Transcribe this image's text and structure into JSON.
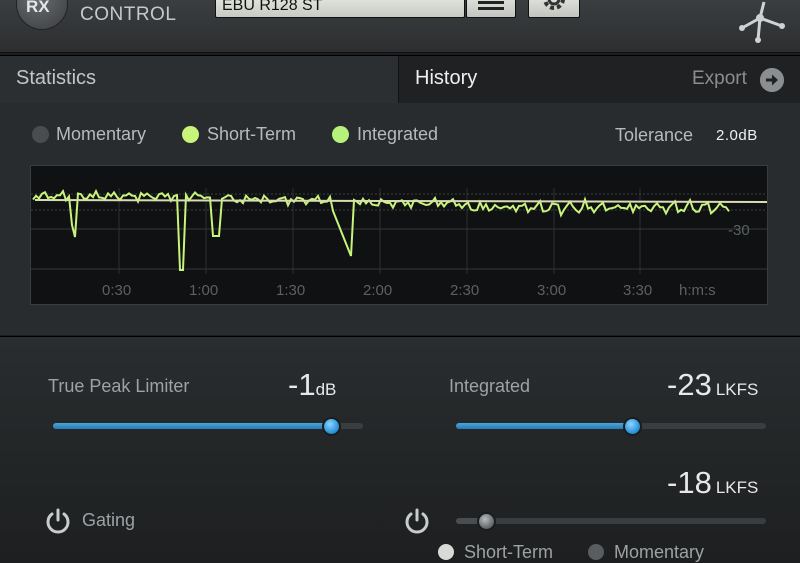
{
  "header": {
    "logo_text": "RX",
    "product_label": "CONTROL",
    "preset_name": "EBU R128 ST"
  },
  "tabs": [
    {
      "label": "Statistics",
      "active": false
    },
    {
      "label": "History",
      "active": true
    }
  ],
  "export_label": "Export",
  "history": {
    "legend": [
      {
        "label": "Momentary",
        "color": "#4a4d50",
        "active": false
      },
      {
        "label": "Short-Term",
        "color": "#c8f47a",
        "active": true
      },
      {
        "label": "Integrated",
        "color": "#b6f27a",
        "active": true
      }
    ],
    "tolerance_label": "Tolerance",
    "tolerance_value": "2.0dB",
    "axis_label_db": "-30",
    "axis_unit": "h:m:s",
    "time_ticks": [
      "0:30",
      "1:00",
      "1:30",
      "2:00",
      "2:30",
      "3:00",
      "3:30"
    ]
  },
  "controls": {
    "true_peak": {
      "label": "True Peak Limiter",
      "value": "-1",
      "unit": "dB",
      "fill_fraction": 0.9
    },
    "integrated": {
      "label": "Integrated",
      "value": "-23",
      "unit": "LKFS",
      "fill_fraction": 0.57
    },
    "short_term": {
      "value": "-18",
      "unit": "LKFS",
      "fill_fraction": 0.1
    },
    "gating_label": "Gating",
    "mode_options": [
      {
        "label": "Short-Term",
        "selected": true
      },
      {
        "label": "Momentary",
        "selected": false
      }
    ]
  },
  "colors": {
    "accent_blue": "#2d97dc",
    "trace_green": "#c8f47a",
    "integrated_line": "#d9dcb0"
  }
}
